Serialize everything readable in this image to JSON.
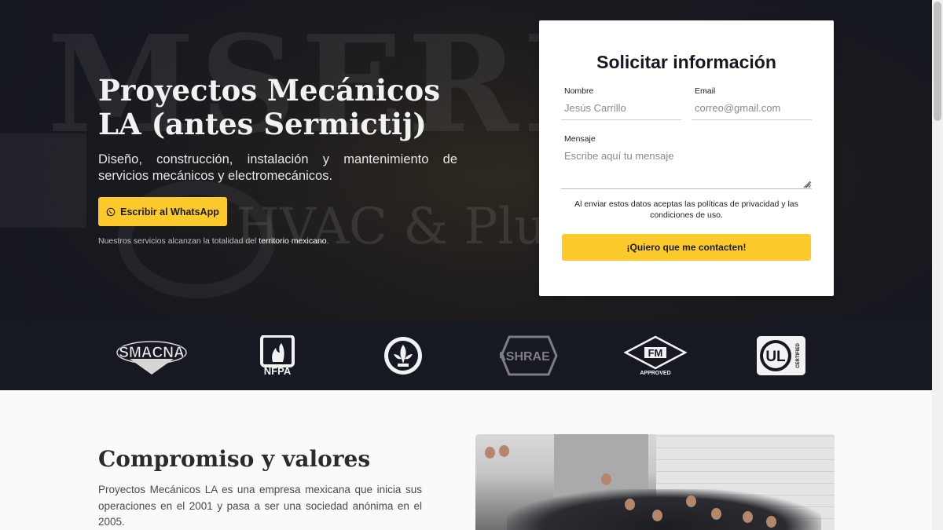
{
  "hero": {
    "title": "Proyectos Mecánicos LA (antes Sermictij)",
    "subtitle": "Diseño, construcción, instalación y mantenimiento de servicios mecánicos y electromecánicos.",
    "whatsapp_label": "Escribir al WhatsApp",
    "note_prefix": "Nuestros servicios alcanzan la totalidad del ",
    "note_highlight": "territorio mexicano",
    "note_suffix": ".",
    "background_sign_top": "MSERM",
    "background_sign_bottom": "HVAC & Plumbin"
  },
  "form": {
    "title": "Solicitar información",
    "name_label": "Nombre",
    "name_placeholder": "Jesús Carrillo",
    "email_label": "Email",
    "email_placeholder": "correo@gmail.com",
    "message_label": "Mensaje",
    "message_placeholder": "Escribe aquí tu mensaje",
    "legal": "Al enviar estos datos aceptas las políticas de privacidad y las condiciones de uso.",
    "submit_label": "¡Quiero que me contacten!"
  },
  "logos": [
    {
      "name": "SMACNA",
      "icon": "smacna-logo"
    },
    {
      "name": "NFPA",
      "icon": "nfpa-logo"
    },
    {
      "name": "U.S. GREEN BUILDING COUNCIL LEED",
      "icon": "usgbc-leed-logo"
    },
    {
      "name": "ASHRAE",
      "icon": "ashrae-logo"
    },
    {
      "name": "FM APPROVED",
      "icon": "fm-approved-logo"
    },
    {
      "name": "UL CERTIFIED",
      "icon": "ul-certified-logo"
    }
  ],
  "logo_text": {
    "smacna": "SMACNA",
    "nfpa": "NFPA",
    "ashrae": "ASHRAE",
    "fm": "FM",
    "fm_sub": "APPROVED",
    "ul": "UL",
    "ul_sub": "CERTIFIED"
  },
  "section": {
    "title": "Compromiso y valores",
    "body": "Proyectos Mecánicos LA es una empresa mexicana que inicia sus operaciones en el 2001 y pasa a ser una sociedad anónima en el 2005."
  },
  "colors": {
    "accent": "#fdca2c",
    "dark_band": "#161822",
    "title_text": "#151822"
  }
}
